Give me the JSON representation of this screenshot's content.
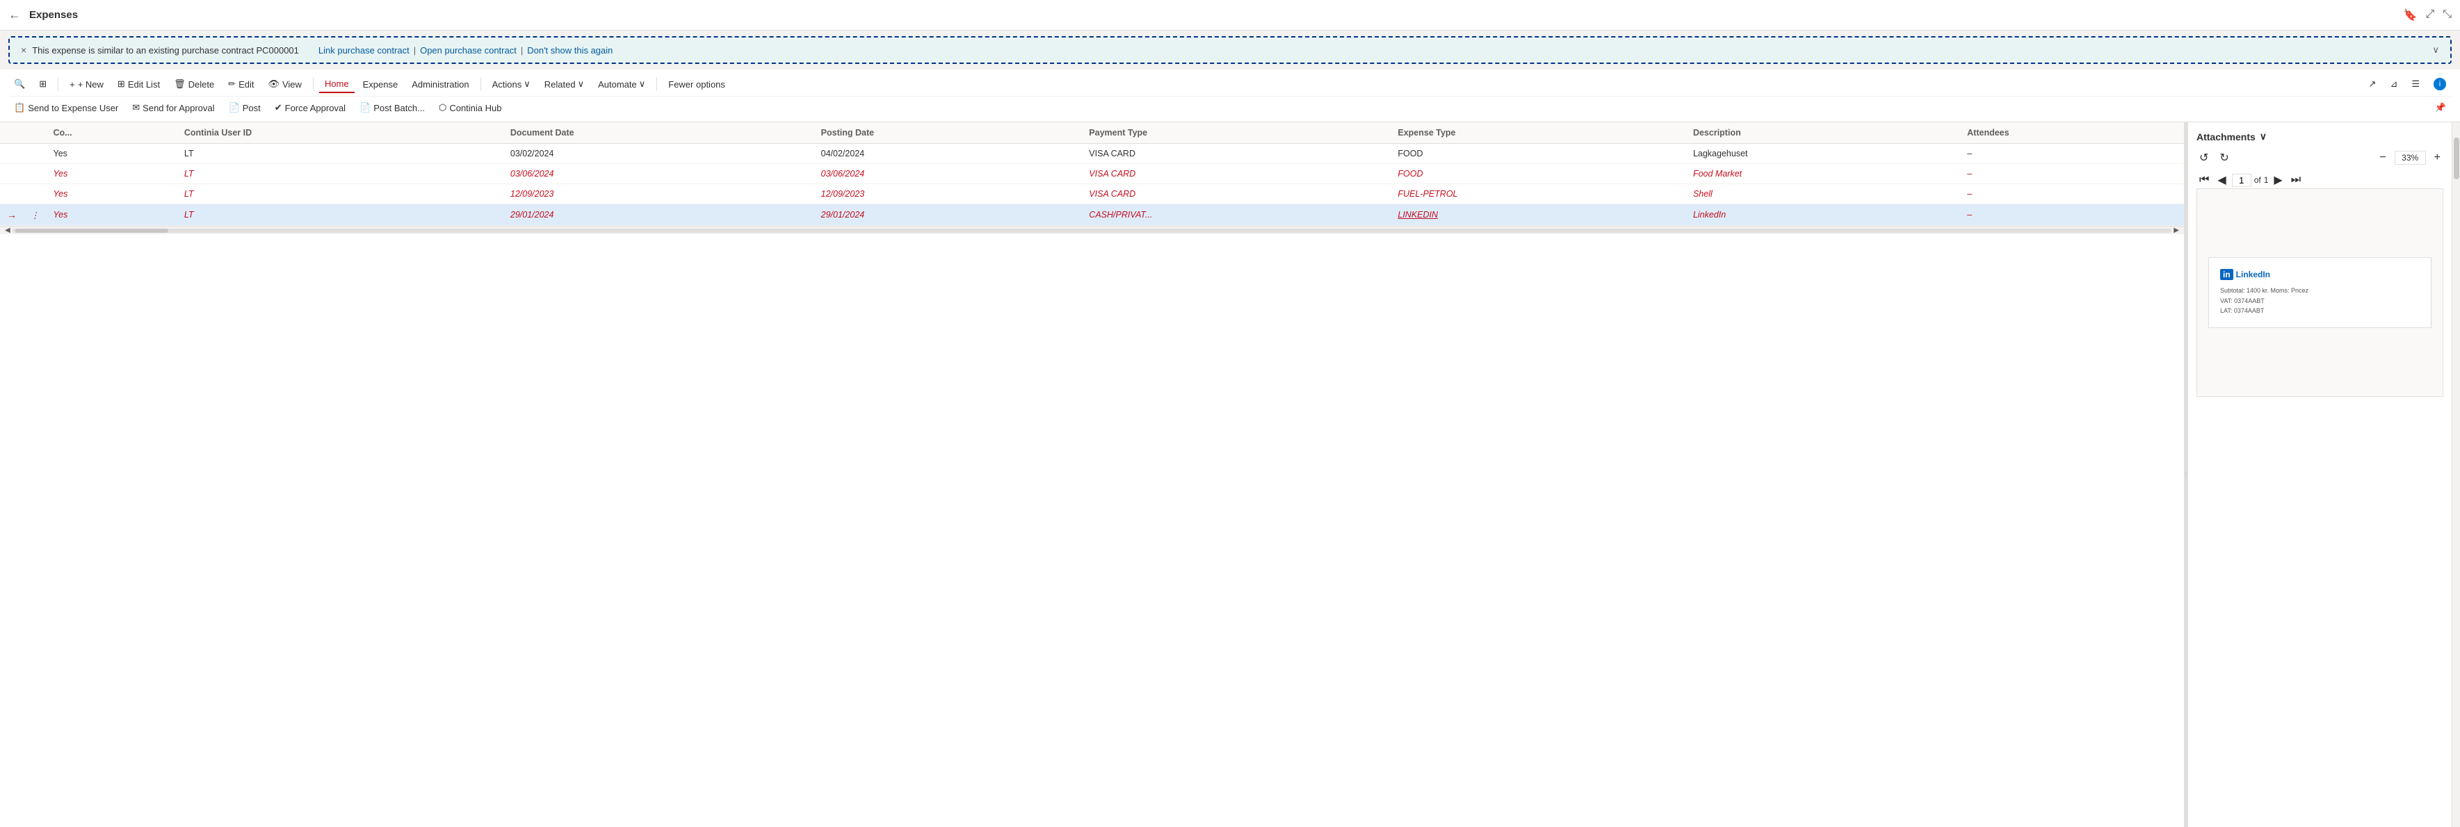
{
  "topBar": {
    "backLabel": "←",
    "title": "Expenses",
    "icons": [
      "bookmark",
      "expand",
      "minimize"
    ]
  },
  "notification": {
    "closeLabel": "×",
    "message": "This expense is similar to an existing purchase contract PC000001",
    "links": [
      {
        "label": "Link purchase contract"
      },
      {
        "label": "Open purchase contract"
      },
      {
        "label": "Don't show this again"
      }
    ],
    "chevron": "∨"
  },
  "ribbon": {
    "row1": {
      "searchIcon": "🔍",
      "buttons": [
        {
          "key": "bookmark2",
          "label": "⬜",
          "icon": true
        },
        {
          "key": "new",
          "label": "+ New"
        },
        {
          "key": "edit-list",
          "label": "Edit List"
        },
        {
          "key": "delete",
          "label": "Delete"
        },
        {
          "key": "edit",
          "label": "Edit"
        },
        {
          "key": "view",
          "label": "View"
        }
      ],
      "tabs": [
        {
          "key": "home",
          "label": "Home",
          "active": true
        },
        {
          "key": "expense",
          "label": "Expense"
        },
        {
          "key": "administration",
          "label": "Administration"
        }
      ],
      "dropdownTabs": [
        {
          "key": "actions",
          "label": "Actions"
        },
        {
          "key": "related",
          "label": "Related"
        },
        {
          "key": "automate",
          "label": "Automate"
        }
      ],
      "fewerOptions": "Fewer options",
      "rightIcons": [
        "share",
        "filter",
        "list",
        "info"
      ]
    },
    "row2": {
      "buttons": [
        {
          "key": "send-to-expense-user",
          "label": "Send to Expense User",
          "icon": "📋"
        },
        {
          "key": "send-for-approval",
          "label": "Send for Approval",
          "icon": "✉"
        },
        {
          "key": "post",
          "label": "Post",
          "icon": "📄"
        },
        {
          "key": "force-approval",
          "label": "Force Approval",
          "icon": "✔"
        },
        {
          "key": "post-batch",
          "label": "Post Batch...",
          "icon": "📄"
        },
        {
          "key": "continia-hub",
          "label": "Continia Hub",
          "icon": "⬡"
        }
      ],
      "pinIcon": "📌"
    }
  },
  "table": {
    "columns": [
      {
        "key": "co",
        "label": "Co..."
      },
      {
        "key": "continia-user-id",
        "label": "Continia User ID"
      },
      {
        "key": "document-date",
        "label": "Document Date"
      },
      {
        "key": "posting-date",
        "label": "Posting Date"
      },
      {
        "key": "payment-type",
        "label": "Payment Type"
      },
      {
        "key": "expense-type",
        "label": "Expense Type"
      },
      {
        "key": "description",
        "label": "Description"
      },
      {
        "key": "attendees",
        "label": "Attendees"
      }
    ],
    "rows": [
      {
        "key": "row1",
        "style": "normal",
        "selected": false,
        "arrow": "",
        "dots": "",
        "co": "Yes",
        "continiaUserId": "LT",
        "documentDate": "03/02/2024",
        "postingDate": "04/02/2024",
        "paymentType": "VISA CARD",
        "expenseType": "FOOD",
        "description": "Lagkagehuset",
        "attendees": "–"
      },
      {
        "key": "row2",
        "style": "red",
        "selected": false,
        "arrow": "",
        "dots": "",
        "co": "Yes",
        "continiaUserId": "LT",
        "documentDate": "03/06/2024",
        "postingDate": "03/06/2024",
        "paymentType": "VISA CARD",
        "expenseType": "FOOD",
        "description": "Food Market",
        "attendees": "–"
      },
      {
        "key": "row3",
        "style": "red",
        "selected": false,
        "arrow": "",
        "dots": "",
        "co": "Yes",
        "continiaUserId": "LT",
        "documentDate": "12/09/2023",
        "postingDate": "12/09/2023",
        "paymentType": "VISA CARD",
        "expenseType": "FUEL-PETROL",
        "description": "Shell",
        "attendees": "–"
      },
      {
        "key": "row4",
        "style": "red",
        "selected": true,
        "arrow": "→",
        "dots": "⋮",
        "co": "Yes",
        "continiaUserId": "LT",
        "documentDate": "29/01/2024",
        "postingDate": "29/01/2024",
        "paymentType": "CASH/PRIVAT...",
        "expenseType": "LINKEDIN",
        "description": "LinkedIn",
        "attendees": "–"
      }
    ]
  },
  "attachments": {
    "title": "Attachments",
    "chevron": "∨",
    "controls": {
      "undoLabel": "↺",
      "redoLabel": "↻",
      "zoomOut": "−",
      "zoomLevel": "33%",
      "zoomIn": "+",
      "firstPage": "⏮",
      "prevPage": "◀",
      "currentPage": "1",
      "ofLabel": "of",
      "totalPages": "1",
      "nextPage": "▶",
      "lastPage": "⏭"
    },
    "receipt": {
      "logoText": "in",
      "companyLine1": "LinkedIn",
      "receiptLine1": "Subtotal: 1400 kr. Moms: Pricez",
      "receiptLine2": "VAT: 0374AABT",
      "receiptLine3": "LAT: 0374AABT"
    }
  }
}
